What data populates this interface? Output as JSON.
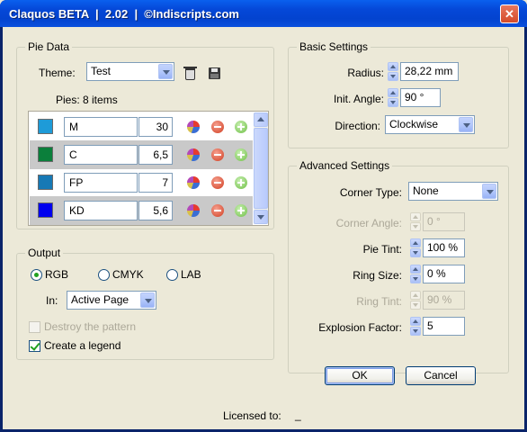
{
  "window": {
    "title": "Claquos BETA  |  2.02  |  ©Indiscripts.com",
    "close_glyph": "✕"
  },
  "pie_data": {
    "group_label": "Pie Data",
    "theme_label": "Theme:",
    "theme_value": "Test",
    "pies_label": "Pies:  8 items",
    "rows": [
      {
        "color": "#1e9bd8",
        "name": "M",
        "value": "30"
      },
      {
        "color": "#0b7f3b",
        "name": "C",
        "value": "6,5"
      },
      {
        "color": "#1779b5",
        "name": "FP",
        "value": "7"
      },
      {
        "color": "#0000ee",
        "name": "KD",
        "value": "5,6"
      }
    ]
  },
  "basic_settings": {
    "group_label": "Basic Settings",
    "radius_label": "Radius:",
    "radius_value": "28,22 mm",
    "angle_label": "Init. Angle:",
    "angle_value": "90 °",
    "direction_label": "Direction:",
    "direction_value": "Clockwise"
  },
  "advanced_settings": {
    "group_label": "Advanced Settings",
    "corner_type_label": "Corner Type:",
    "corner_type_value": "None",
    "corner_angle_label": "Corner Angle:",
    "corner_angle_value": "0 °",
    "pie_tint_label": "Pie Tint:",
    "pie_tint_value": "100 %",
    "ring_size_label": "Ring Size:",
    "ring_size_value": "0 %",
    "ring_tint_label": "Ring Tint:",
    "ring_tint_value": "90 %",
    "explosion_label": "Explosion Factor:",
    "explosion_value": "5"
  },
  "output": {
    "group_label": "Output",
    "radio_rgb": "RGB",
    "radio_cmyk": "CMYK",
    "radio_lab": "LAB",
    "in_label": "In:",
    "in_value": "Active Page",
    "destroy_label": "Destroy the pattern",
    "legend_label": "Create a legend"
  },
  "buttons": {
    "ok": "OK",
    "cancel": "Cancel"
  },
  "footer": {
    "licensed_label": "Licensed to:",
    "licensed_value": "_"
  }
}
